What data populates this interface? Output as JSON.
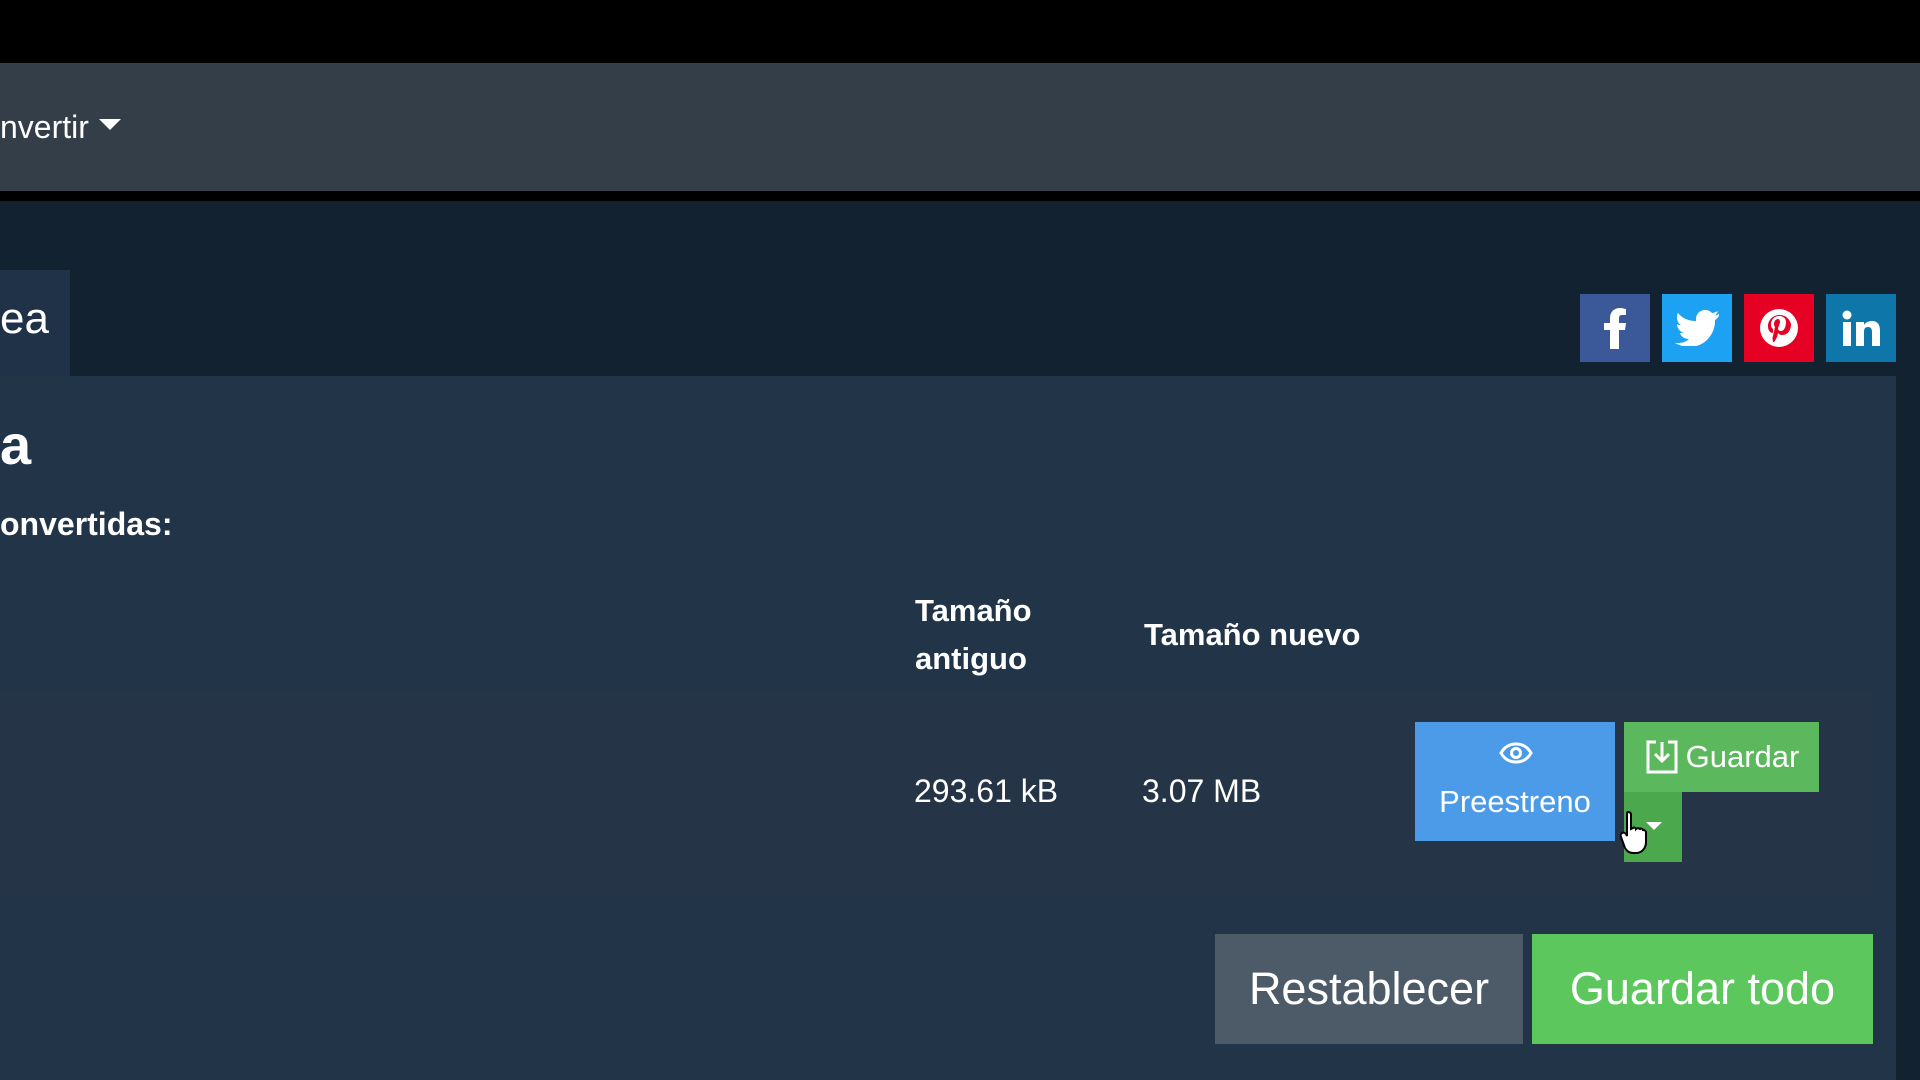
{
  "navbar": {
    "convert_menu_label": "nvertir"
  },
  "tab": {
    "label": "ea"
  },
  "share": {
    "facebook_icon": "facebook-icon",
    "twitter_icon": "twitter-icon",
    "pinterest_icon": "pinterest-icon",
    "linkedin_icon": "linkedin-icon",
    "colors": {
      "facebook": "#3b5998",
      "twitter": "#1da1f2",
      "pinterest": "#e60023",
      "linkedin": "#0e76a8"
    }
  },
  "main": {
    "heading": "a",
    "subheading": "onvertidas:"
  },
  "table": {
    "headers": {
      "old_size_line1": "Tamaño",
      "old_size_line2": "antiguo",
      "new_size": "Tamaño nuevo"
    },
    "rows": [
      {
        "old_size": "293.61 kB",
        "new_size": "3.07 MB",
        "preview_label": "Preestreno",
        "save_label": "Guardar"
      }
    ]
  },
  "actions": {
    "reset_label": "Restablecer",
    "save_all_label": "Guardar todo"
  },
  "colors": {
    "preview_button": "#4c9be8",
    "save_button": "#5cb85c",
    "reset_button": "#4d5a67",
    "save_all_button": "#5cc75c"
  }
}
